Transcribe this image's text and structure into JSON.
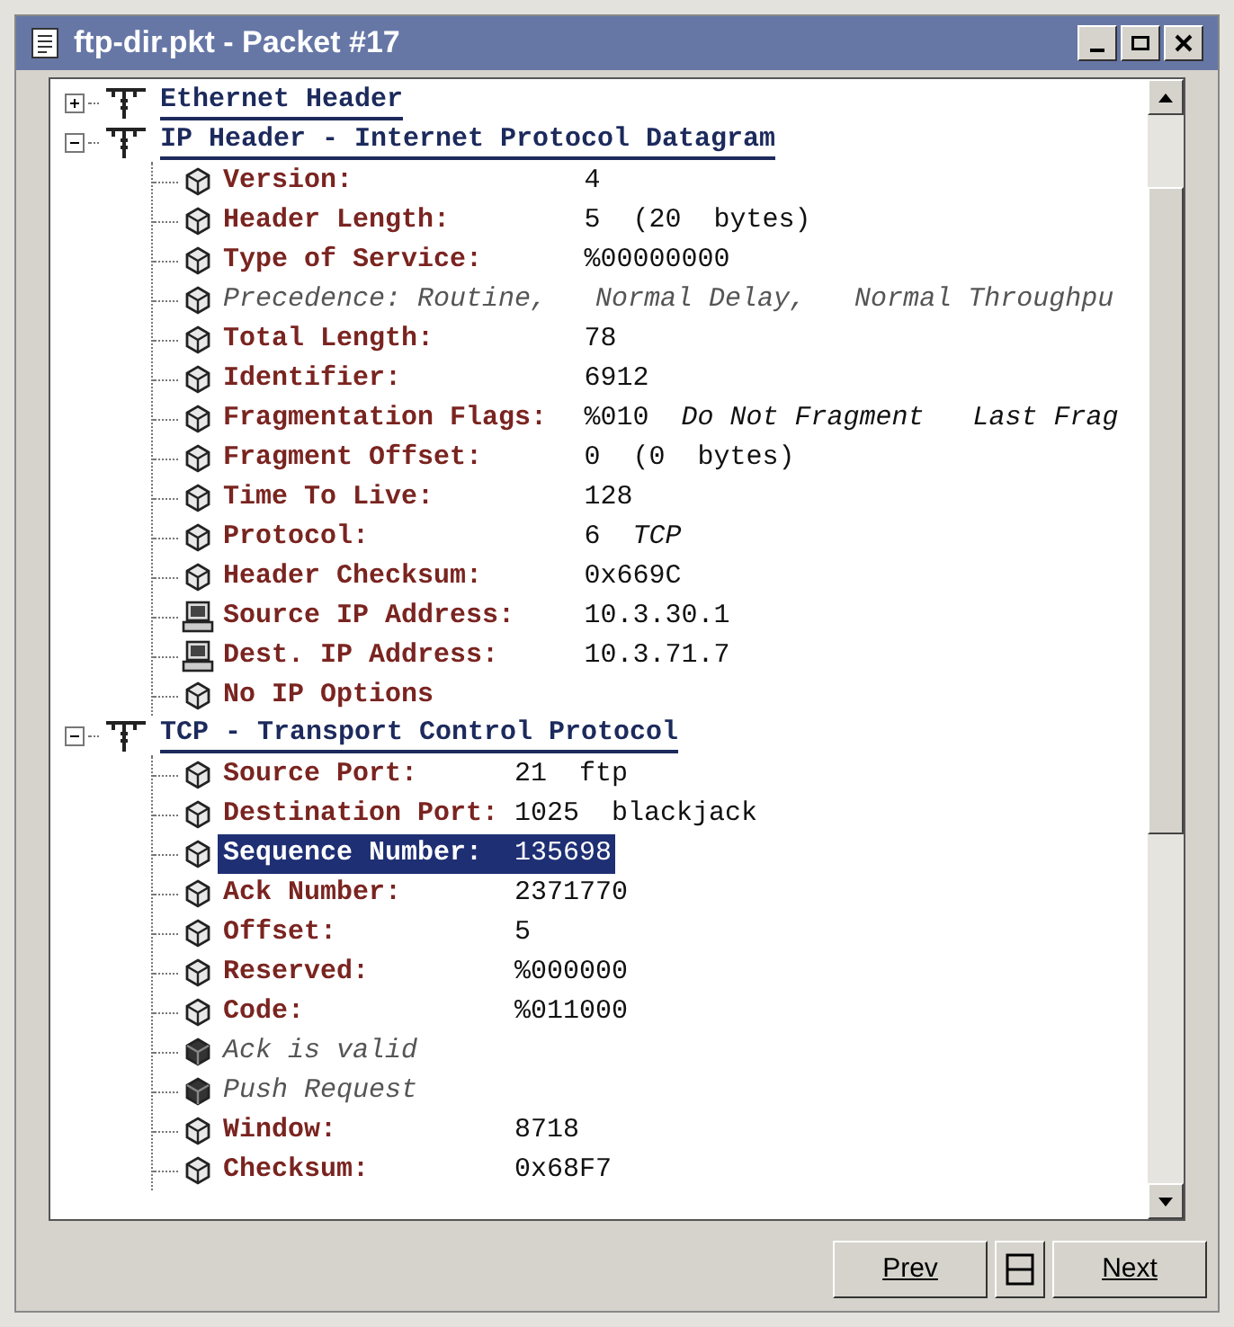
{
  "window": {
    "title": "ftp-dir.pkt - Packet #17"
  },
  "sections": [
    {
      "title": "Ethernet Header",
      "expanded": false
    },
    {
      "title": "IP Header - Internet Protocol Datagram",
      "expanded": true,
      "items": [
        {
          "kind": "field",
          "label": "Version:",
          "value": "4",
          "selected": false
        },
        {
          "kind": "field",
          "label": "Header Length:",
          "value": "5  (20  bytes)",
          "selected": false
        },
        {
          "kind": "field",
          "label": "Type of Service:",
          "value": "%00000000",
          "selected": false
        },
        {
          "kind": "note",
          "label": "Precedence: Routine,   Normal Delay,   Normal Throughpu",
          "selected": false
        },
        {
          "kind": "field",
          "label": "Total Length:",
          "value": "78",
          "selected": false
        },
        {
          "kind": "field",
          "label": "Identifier:",
          "value": "6912",
          "selected": false
        },
        {
          "kind": "field",
          "label": "Fragmentation Flags:",
          "value": "%010  *Do Not Fragment   Last Frag*",
          "selected": false
        },
        {
          "kind": "field",
          "label": "Fragment Offset:",
          "value": "0  (0  bytes)",
          "selected": false
        },
        {
          "kind": "field",
          "label": "Time To Live:",
          "value": "128",
          "selected": false
        },
        {
          "kind": "field",
          "label": "Protocol:",
          "value": "6  *TCP*",
          "selected": false
        },
        {
          "kind": "field",
          "label": "Header Checksum:",
          "value": "0x669C",
          "selected": false
        },
        {
          "kind": "address",
          "label": "Source IP Address:",
          "value": "10.3.30.1",
          "selected": false
        },
        {
          "kind": "address",
          "label": "Dest. IP Address:",
          "value": "10.3.71.7",
          "selected": false
        },
        {
          "kind": "item",
          "label": "No IP Options",
          "selected": false
        }
      ]
    },
    {
      "title": "TCP - Transport Control Protocol",
      "expanded": true,
      "items": [
        {
          "kind": "field",
          "label": "Source Port:",
          "value": "21  ftp",
          "selected": false
        },
        {
          "kind": "field",
          "label": "Destination Port:",
          "value": "1025  blackjack",
          "selected": false
        },
        {
          "kind": "field",
          "label": "Sequence Number:",
          "value": "135698",
          "selected": true
        },
        {
          "kind": "field",
          "label": "Ack Number:",
          "value": "2371770",
          "selected": false
        },
        {
          "kind": "field",
          "label": "Offset:",
          "value": "5",
          "selected": false
        },
        {
          "kind": "field",
          "label": "Reserved:",
          "value": "%000000",
          "selected": false
        },
        {
          "kind": "field",
          "label": "Code:",
          "value": "%011000",
          "selected": false
        },
        {
          "kind": "flag",
          "label": "Ack is valid",
          "selected": false
        },
        {
          "kind": "flag",
          "label": "Push Request",
          "selected": false
        },
        {
          "kind": "field",
          "label": "Window:",
          "value": "8718",
          "selected": false
        },
        {
          "kind": "field",
          "label": "Checksum:",
          "value": "0x68F7",
          "selected": false
        }
      ]
    }
  ],
  "buttons": {
    "prev": "Prev",
    "next": "Next"
  }
}
